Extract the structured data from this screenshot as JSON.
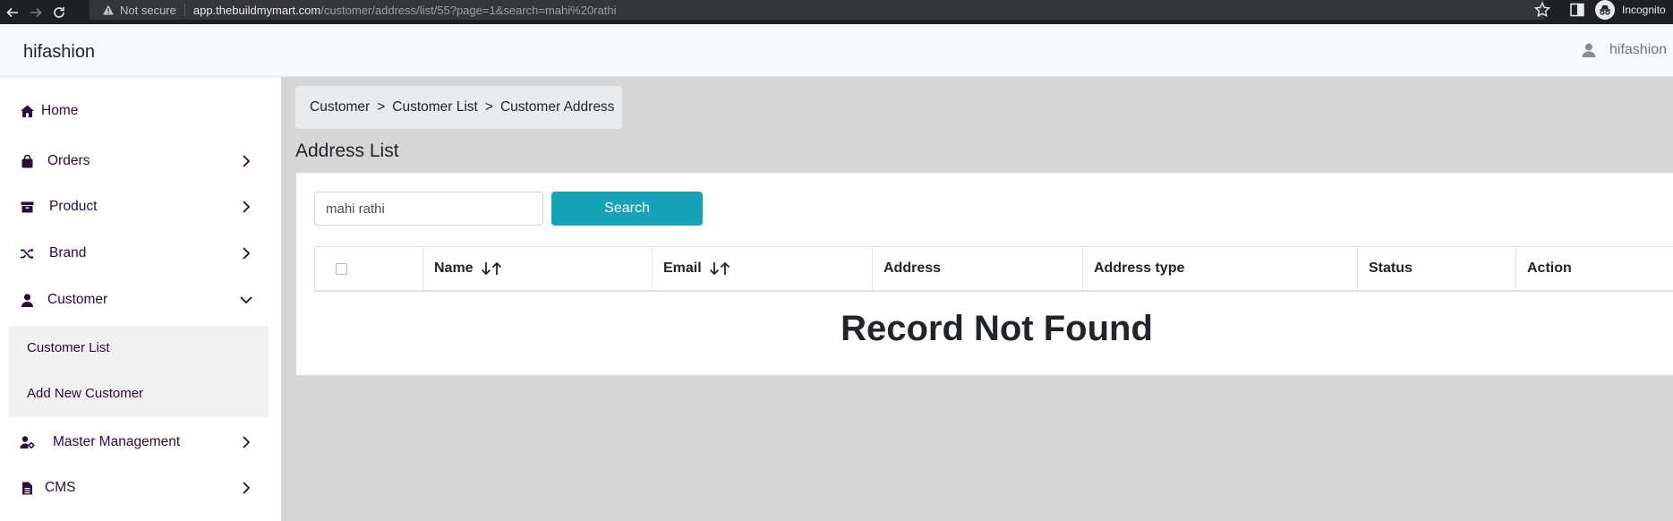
{
  "browser": {
    "not_secure": "Not secure",
    "url_host": "app.thebuildmymart.com",
    "url_path": "/customer/address/list/55?page=1&search=mahi%20rathi",
    "mode_label": "Incognito"
  },
  "header": {
    "brand": "hifashion",
    "user_name": "hifashion"
  },
  "sidebar": {
    "items": [
      {
        "label": "Home",
        "icon": "home-icon"
      },
      {
        "label": "Orders",
        "icon": "shopping-bag-icon"
      },
      {
        "label": "Product",
        "icon": "archive-box-icon"
      },
      {
        "label": "Brand",
        "icon": "shuffle-icon"
      },
      {
        "label": "Customer",
        "icon": "user-icon"
      },
      {
        "label": "Master Management",
        "icon": "user-gear-icon"
      },
      {
        "label": "CMS",
        "icon": "document-icon"
      }
    ],
    "customer_sub": [
      "Customer List",
      "Add New Customer"
    ]
  },
  "breadcrumb": {
    "items": [
      "Customer",
      "Customer List",
      "Customer Address"
    ],
    "separator": ">"
  },
  "page": {
    "title": "Address List"
  },
  "search": {
    "value": "mahi rathi",
    "button_label": "Search"
  },
  "table": {
    "columns": [
      "",
      "Name",
      "Email",
      "Address",
      "Address type",
      "Status",
      "Action"
    ],
    "empty_message": "Record Not Found"
  },
  "colors": {
    "accent": "#17a2b8",
    "sidebar_text": "#2b0a3d",
    "content_bg": "#d6d6d6"
  }
}
